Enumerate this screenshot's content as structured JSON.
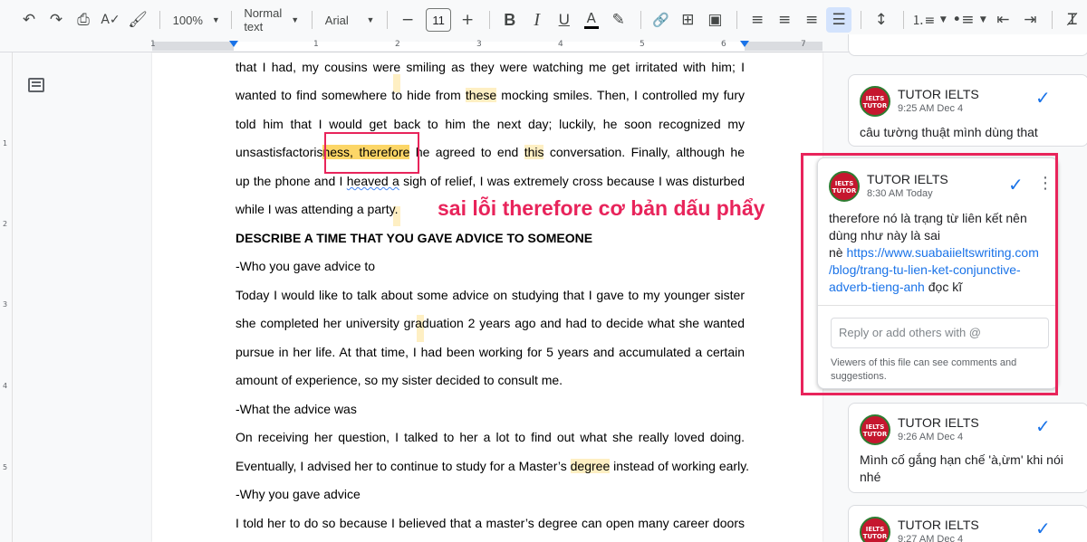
{
  "toolbar": {
    "zoom": "100%",
    "style": "Normal text",
    "font": "Arial",
    "font_size": "11",
    "minus": "−",
    "plus": "+",
    "bold": "B",
    "italic": "I",
    "underline": "U",
    "text_color": "A",
    "icons": [
      "undo-icon",
      "redo-icon",
      "print-icon",
      "spellcheck-icon",
      "paint-format-icon",
      "highlighter-icon",
      "link-icon",
      "add-comment-icon",
      "image-icon",
      "align-left-icon",
      "align-center-icon",
      "align-right-icon",
      "justify-icon",
      "line-spacing-icon",
      "numbered-list-icon",
      "bulleted-list-icon",
      "decrease-indent-icon",
      "increase-indent-icon",
      "clear-formatting-icon"
    ]
  },
  "ruler": {
    "h_numbers": [
      "1",
      "1",
      "2",
      "3",
      "4",
      "5",
      "6",
      "7"
    ],
    "v_numbers": [
      "1",
      "2",
      "3",
      "4",
      "5"
    ]
  },
  "document": {
    "l1": "that I had, my cousins were smiling as they were watching me get irritated with him; I solely",
    "l2a": "wanted to find somewhere to hide from ",
    "l2b": "these",
    "l2c": " mocking smiles. Then, I controlled my fury and",
    "l3": "told him that I would get back to him the next day; luckily, he soon recognized my",
    "l4a": "unsastisfactoris",
    "l4b": "ness, therefore",
    "l4c": " he agreed to end ",
    "l4d": "this",
    "l4e": " conversation. Finally, although he hung",
    "l5a": "up the phone and I ",
    "l5b": "heaved a",
    "l5c": " sigh of relief, I was extremely cross because I was disturbed",
    "l6": "while I was attending a party.",
    "l7": "DESCRIBE A TIME THAT YOU GAVE ADVICE TO SOMEONE",
    "l8": "-Who you gave advice to",
    "l9": "Today I would like to talk about some advice on studying that I gave to my younger sister when",
    "l10": "she completed her university graduation 2 years ago and had to decide what she wanted to",
    "l11": "pursue in her life. At that time, I had been working for 5 years and accumulated a certain",
    "l12": "amount of experience, so my sister decided to consult me.",
    "l13": "-What the advice was",
    "l14": "On receiving her question, I talked to her a lot to find out what she really loved doing.",
    "l15a": "Eventually, I advised her to continue to study for a Master’s ",
    "l15b": "degree",
    "l15c": " instead of working early.",
    "l16": "-Why you gave advice",
    "l17": "I told her to do so because I believed that a master’s degree can open many career doors for"
  },
  "annotation": "sai lỗi therefore cơ bản dấu phẩy",
  "comments": [
    {
      "author": "TUTOR IELTS",
      "time": "9:25 AM Dec 4",
      "body": "câu tường thuật mình dùng that"
    },
    {
      "author": "TUTOR IELTS",
      "time": "8:30 AM Today",
      "body1": "therefore nó là trạng từ liên kết nên",
      "body2": "dùng như này là sai",
      "body3": "nè ",
      "link1": "https://www.suabaiieltswriting.com",
      "link2": "/blog/trang-tu-lien-ket-conjunctive-",
      "link3": "adverb-tieng-anh",
      "body4": " đọc kĩ",
      "reply_placeholder": "Reply or add others with @",
      "viewers1": "Viewers of this file can see comments and",
      "viewers2": "suggestions."
    },
    {
      "author": "TUTOR IELTS",
      "time": "9:26 AM Dec 4",
      "body1": "Mình cố gắng hạn chế 'à,ừm' khi nói",
      "body2": "nhé"
    },
    {
      "author": "TUTOR IELTS",
      "time": "9:27 AM Dec 4"
    }
  ],
  "avatar_text": "IELTS TUTOR",
  "colors": {
    "accent": "#1a73e8",
    "annotation": "#e8245b",
    "highlight": "#feefc3",
    "highlight_active": "#fcd667"
  }
}
